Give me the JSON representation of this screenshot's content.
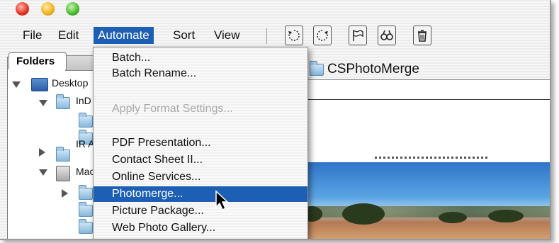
{
  "menubar": {
    "items": [
      "File",
      "Edit",
      "Automate",
      "Sort",
      "View"
    ],
    "active": "Automate"
  },
  "toolbar": {
    "icons": [
      "rotate-counterclockwise-icon",
      "rotate-clockwise-icon",
      "flag-icon",
      "binoculars-icon",
      "trash-icon"
    ]
  },
  "panel": {
    "tab_label": "Folders",
    "tree": [
      {
        "label": "Desktop",
        "expanded": true
      },
      {
        "label": "InD",
        "expanded": true
      },
      {
        "label": "IR A",
        "expanded": false
      },
      {
        "label": "Mac",
        "expanded": true
      }
    ]
  },
  "content": {
    "path_label": "CSPhotoMerge"
  },
  "automate_menu": {
    "items": [
      {
        "label": "Batch...",
        "state": "enabled"
      },
      {
        "label": "Batch Rename...",
        "state": "enabled"
      },
      {
        "label": "Apply Format Settings...",
        "state": "disabled"
      },
      {
        "label": "PDF Presentation...",
        "state": "enabled"
      },
      {
        "label": "Contact Sheet II...",
        "state": "enabled"
      },
      {
        "label": "Online Services...",
        "state": "enabled"
      },
      {
        "label": "Photomerge...",
        "state": "selected"
      },
      {
        "label": "Picture Package...",
        "state": "enabled"
      },
      {
        "label": "Web Photo Gallery...",
        "state": "enabled"
      }
    ]
  },
  "colors": {
    "selection": "#1d5fb4",
    "disabled_text": "#a9a9a9"
  }
}
